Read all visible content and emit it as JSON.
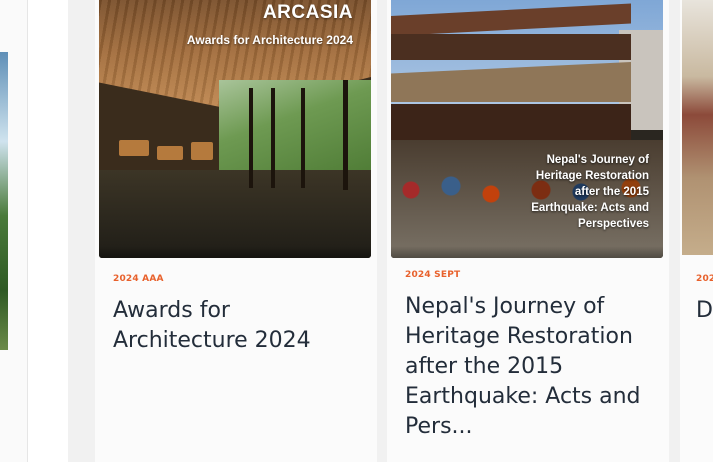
{
  "cards": [
    {
      "cover_title": "ARCASIA",
      "cover_subtitle": "Awards for Architecture 2024",
      "tag": "2024 AAA",
      "headline": "Awards for Architecture 2024"
    },
    {
      "cover_overlay": "Nepal's Journey of Heritage Restoration after the 2015 Earthquake: Acts and Perspectives",
      "tag": "2024 SEPT",
      "headline": "Nepal's Journey of Heritage Restoration after the 2015 Earthquake: Acts and Pers..."
    },
    {
      "tag": "202",
      "headline": "D A"
    }
  ]
}
